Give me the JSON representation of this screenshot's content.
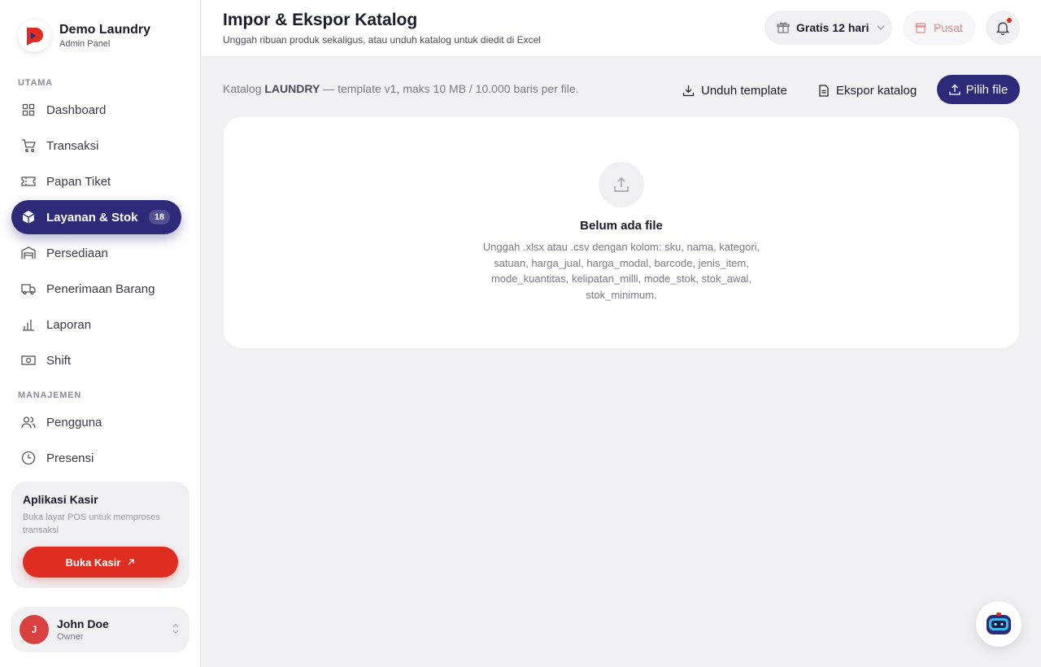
{
  "brand": {
    "name": "Demo Laundry",
    "subtitle": "Admin Panel",
    "logo_icon": "brand-logo-icon"
  },
  "sidebar": {
    "sections": [
      {
        "label": "UTAMA"
      },
      {
        "label": "MANAJEMEN"
      }
    ],
    "items": [
      {
        "label": "Dashboard",
        "icon": "grid-icon"
      },
      {
        "label": "Transaksi",
        "icon": "cart-icon"
      },
      {
        "label": "Papan Tiket",
        "icon": "ticket-icon"
      },
      {
        "label": "Layanan & Stok",
        "icon": "box-icon",
        "active": true,
        "badge": "18"
      },
      {
        "label": "Persediaan",
        "icon": "warehouse-icon"
      },
      {
        "label": "Penerimaan Barang",
        "icon": "truck-icon"
      },
      {
        "label": "Laporan",
        "icon": "bar-chart-icon"
      },
      {
        "label": "Shift",
        "icon": "cash-icon"
      },
      {
        "label": "Pengguna",
        "icon": "users-icon"
      },
      {
        "label": "Presensi",
        "icon": "clock-icon"
      }
    ],
    "kasir_card": {
      "title": "Aplikasi Kasir",
      "description": "Buka layar POS untuk memproses transaksi",
      "button_label": "Buka Kasir"
    },
    "user": {
      "initial": "J",
      "name": "John Doe",
      "role": "Owner"
    }
  },
  "header": {
    "title": "Impor & Ekspor Katalog",
    "subtitle": "Unggah ribuan produk sekaligus, atau unduh katalog untuk diedit di Excel",
    "trial_label": "Gratis 12 hari",
    "pusat_label": "Pusat"
  },
  "main": {
    "info": {
      "prefix": "Katalog ",
      "catalog_name": "LAUNDRY",
      "suffix": " — template v1, maks 10 MB / 10.000 baris per file."
    },
    "actions": {
      "download_template": "Unduh template",
      "export_catalog": "Ekspor katalog",
      "choose_file": "Pilih file"
    },
    "empty_state": {
      "title": "Belum ada file",
      "description": "Unggah .xlsx atau .csv dengan kolom: sku, nama, kategori, satuan, harga_jual, harga_modal, barcode, jenis_item, mode_kuantitas, kelipatan_milli, mode_stok, stok_awal, stok_minimum."
    }
  },
  "colors": {
    "primary": "#2e2a7a",
    "accent_red": "#e02d22",
    "background": "#f1f1f4"
  }
}
